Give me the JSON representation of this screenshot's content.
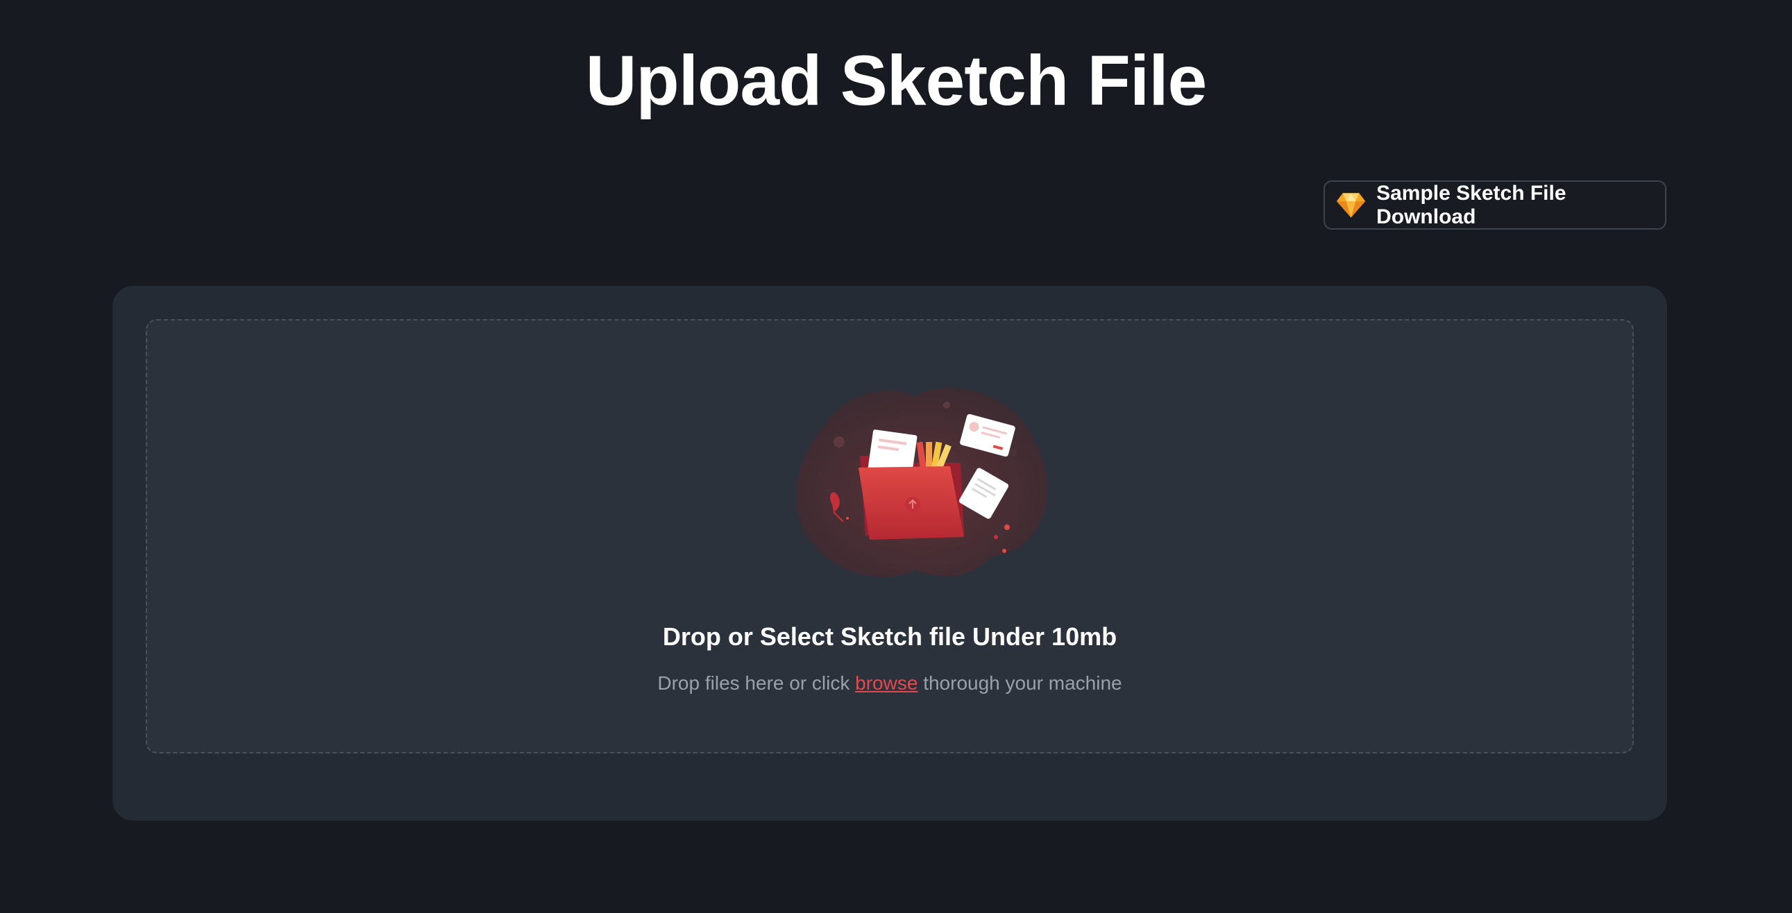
{
  "page": {
    "title": "Upload Sketch File"
  },
  "sample_download": {
    "label": "Sample Sketch File Download",
    "icon": "sketch-gem-icon"
  },
  "dropzone": {
    "heading": "Drop or Select Sketch file Under 10mb",
    "sub_before": "Drop files here or click",
    "browse_label": "browse",
    "sub_after": "thorough your machine",
    "illustration": "folder-with-files-illustration"
  },
  "colors": {
    "background": "#171b21",
    "card": "#252b34",
    "dropzone": "#2c323c",
    "accent": "#e5484d",
    "muted_text": "#9aa1ab"
  }
}
